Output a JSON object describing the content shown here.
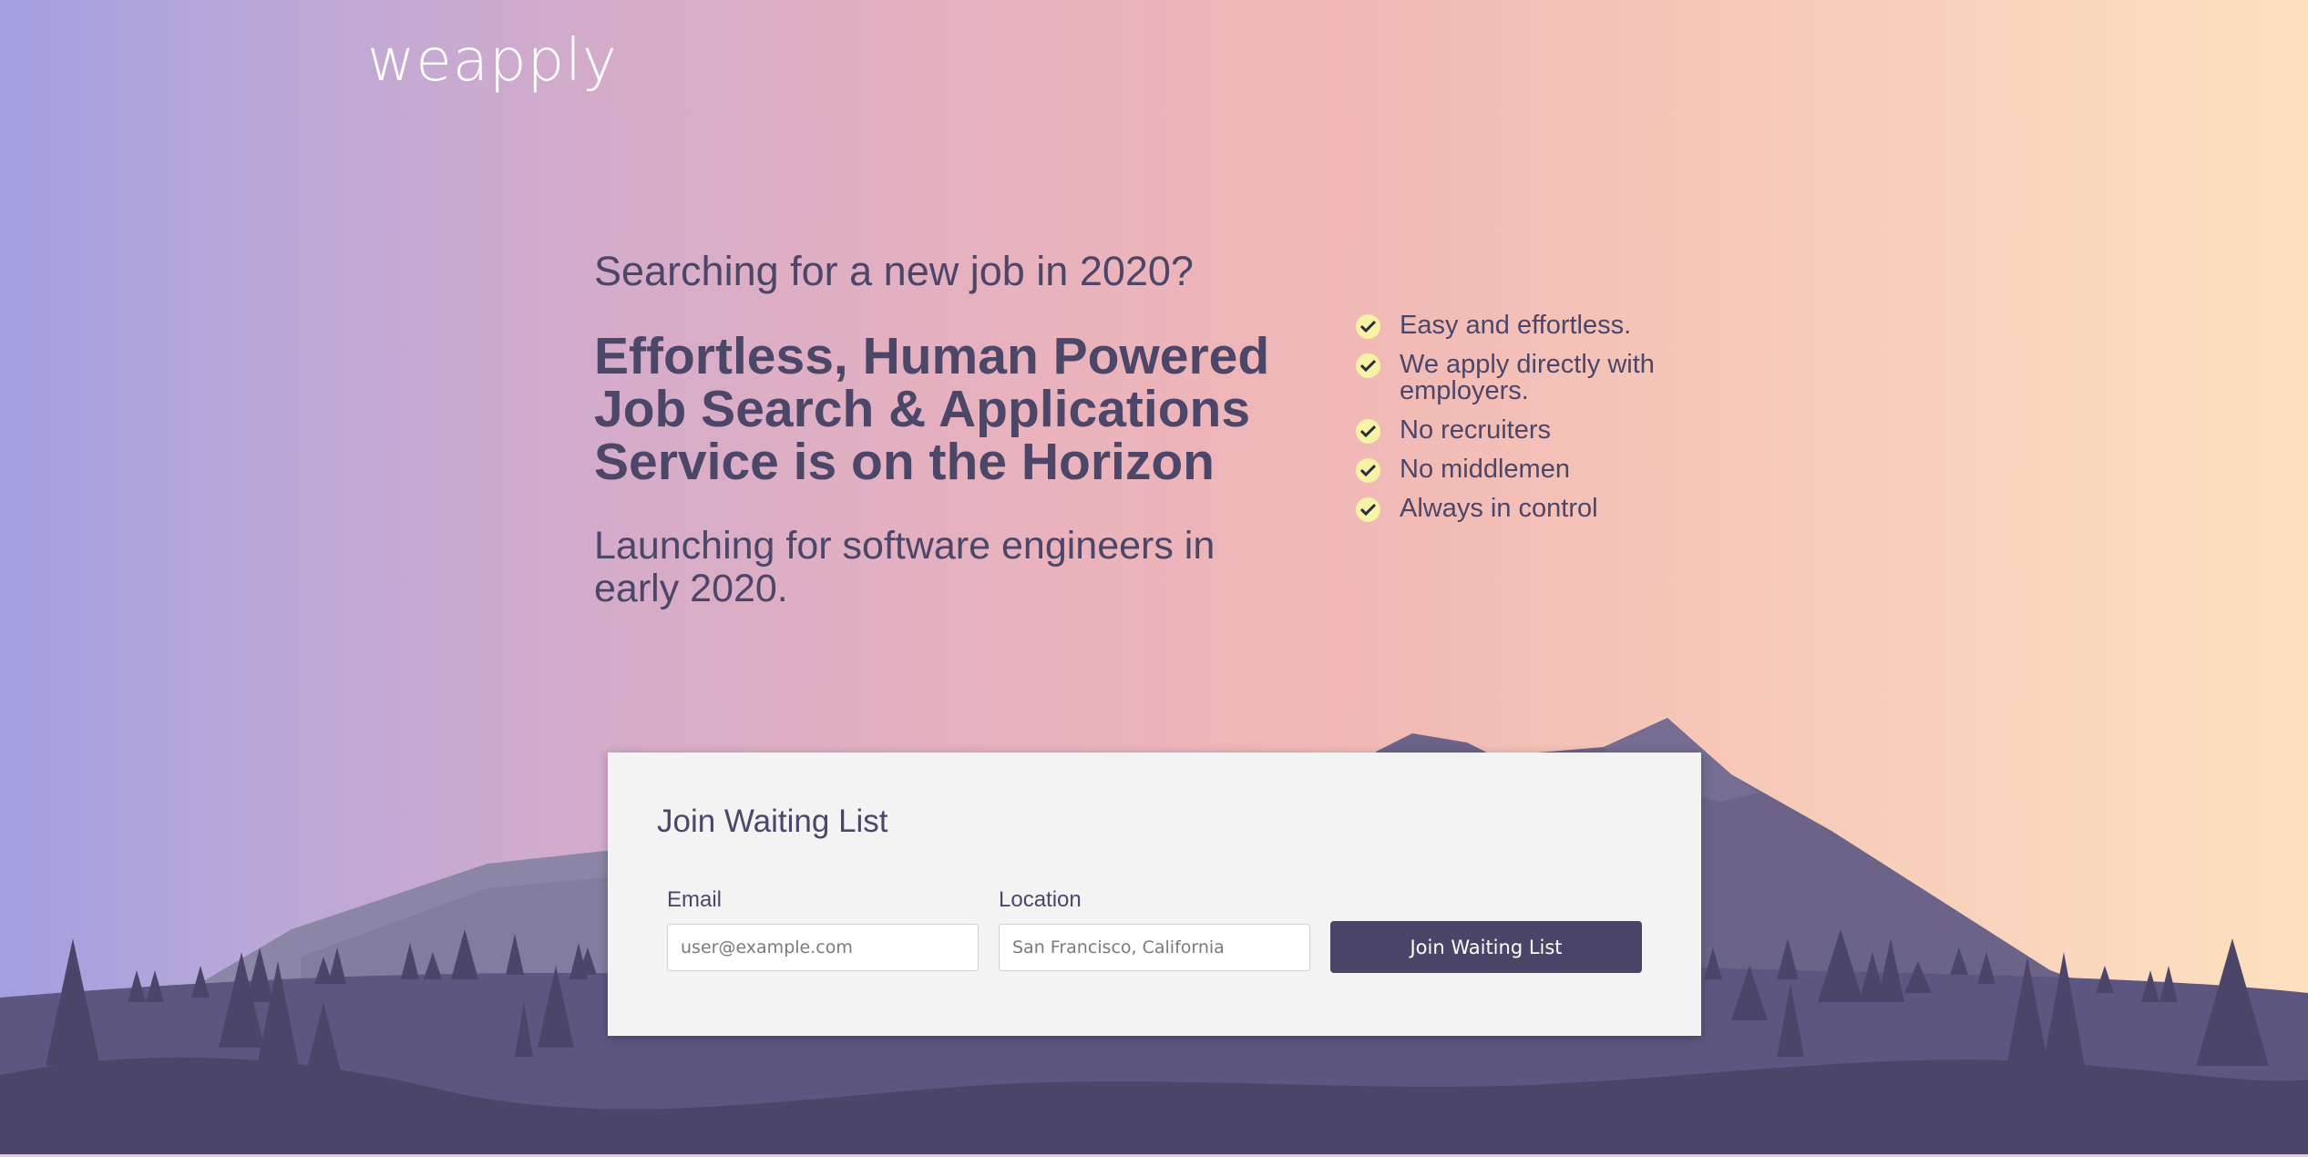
{
  "brand": {
    "logo_text": "weapply"
  },
  "hero": {
    "kicker": "Searching for a new job in 2020?",
    "headline": "Effortless, Human Powered Job Search & Applications Service is on the Horizon",
    "subheadline": "Launching for software engineers in early 2020."
  },
  "features": [
    {
      "label": "Easy and effortless.",
      "icon": "check-icon"
    },
    {
      "label": "We apply directly with employers.",
      "icon": "check-icon"
    },
    {
      "label": "No recruiters",
      "icon": "check-icon"
    },
    {
      "label": "No middlemen",
      "icon": "check-icon"
    },
    {
      "label": "Always in control",
      "icon": "check-icon"
    }
  ],
  "waitlist": {
    "title": "Join Waiting List",
    "email_label": "Email",
    "email_placeholder": "user@example.com",
    "email_value": "",
    "location_label": "Location",
    "location_placeholder": "San Francisco, California",
    "location_value": "",
    "submit_label": "Join Waiting List"
  },
  "colors": {
    "text": "#4c4669",
    "button": "#4b4469",
    "check_badge": "#f6f2a6",
    "card": "#f3f3f3"
  }
}
